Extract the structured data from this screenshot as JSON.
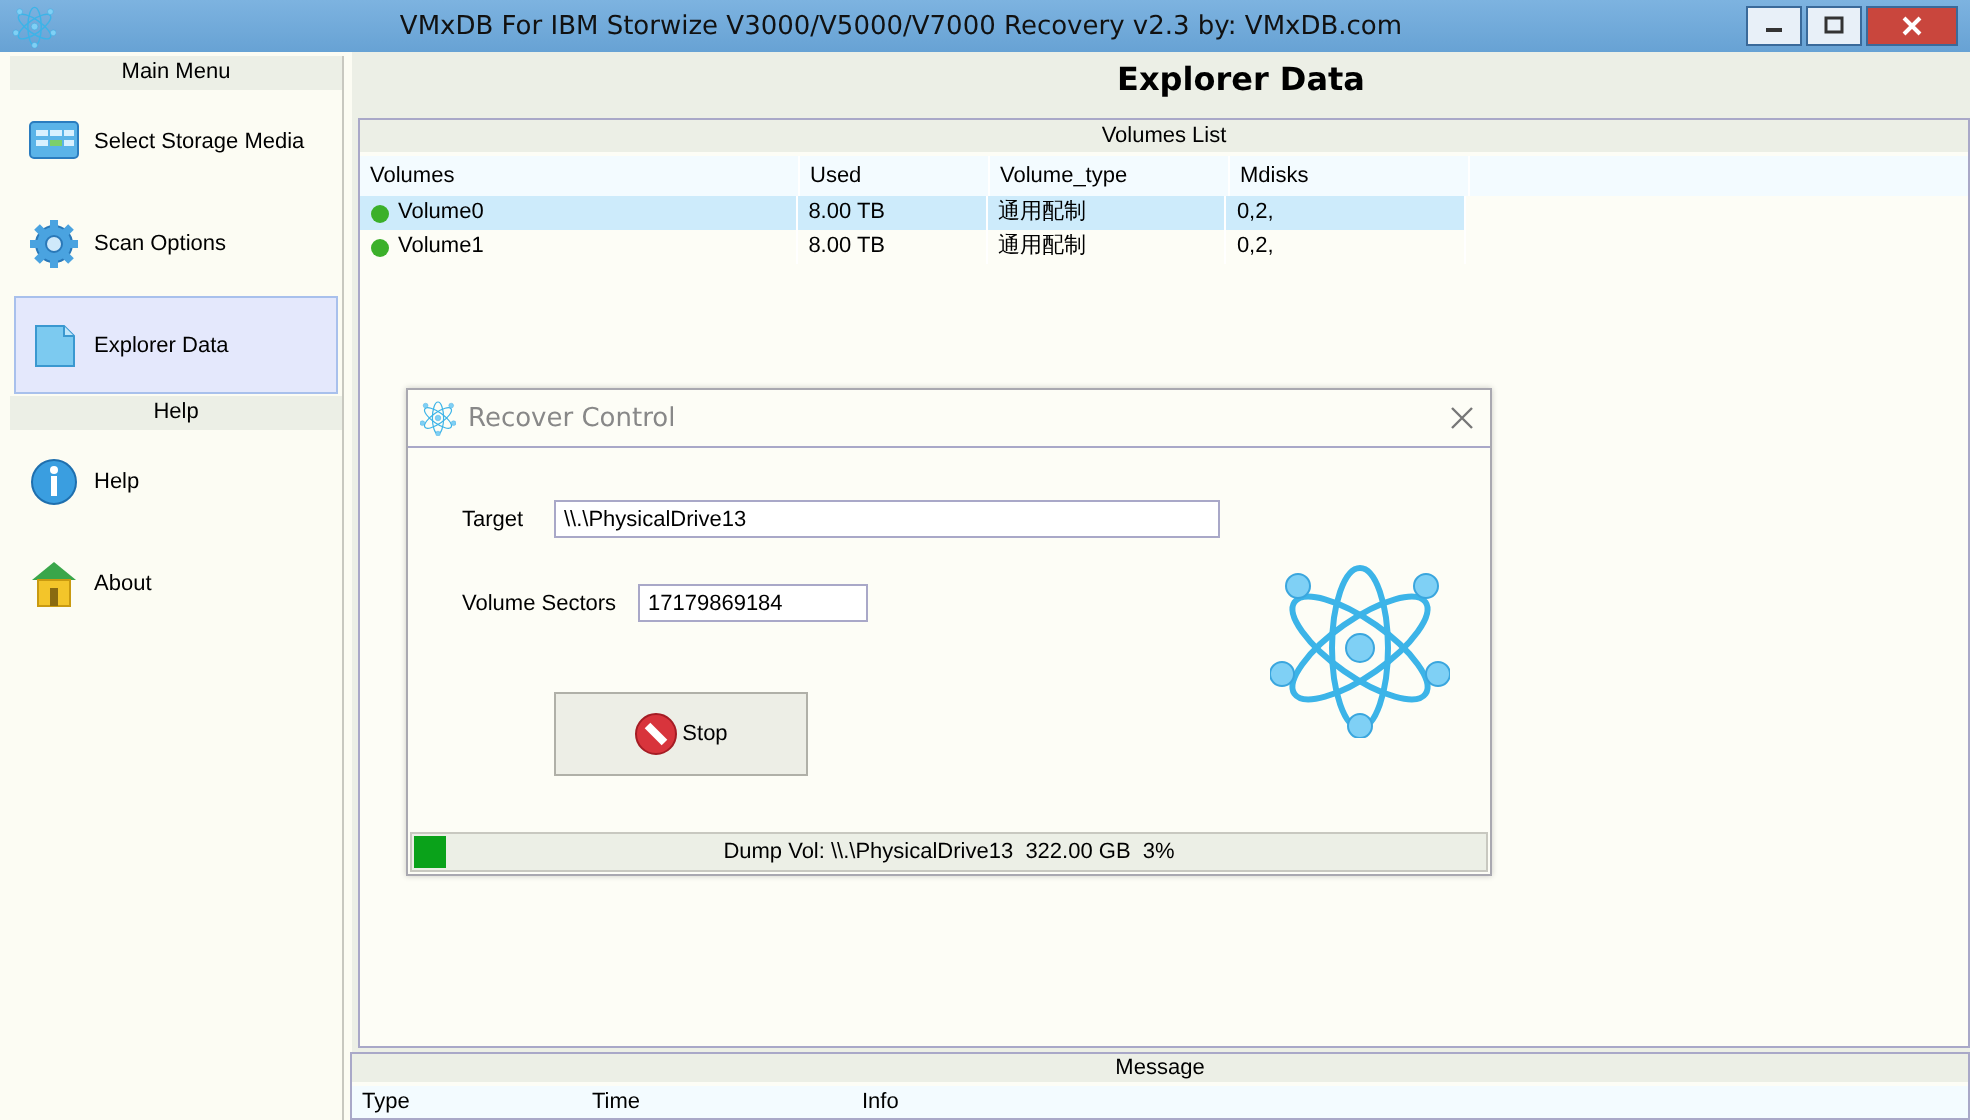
{
  "window": {
    "title": "VMxDB For IBM Storwize V3000/V5000/V7000 Recovery v2.3 by: VMxDB.com"
  },
  "sidebar": {
    "sections": [
      {
        "header": "Main Menu",
        "items": [
          {
            "label": "Select Storage Media",
            "selected": false
          },
          {
            "label": "Scan Options",
            "selected": false
          },
          {
            "label": "Explorer Data",
            "selected": true
          }
        ]
      },
      {
        "header": "Help",
        "items": [
          {
            "label": "Help",
            "selected": false
          },
          {
            "label": "About",
            "selected": false
          }
        ]
      }
    ]
  },
  "heading": "Explorer Data",
  "volumes_list": {
    "title": "Volumes List",
    "columns": [
      "Volumes",
      "Used",
      "Volume_type",
      "Mdisks"
    ],
    "rows": [
      {
        "cells": [
          "Volume0",
          "8.00 TB",
          "通用配制",
          "0,2,"
        ],
        "selected": true
      },
      {
        "cells": [
          "Volume1",
          "8.00 TB",
          "通用配制",
          "0,2,"
        ],
        "selected": false
      }
    ]
  },
  "dialog": {
    "title": "Recover Control",
    "fields": [
      {
        "label": "Target",
        "value": "\\\\.\\PhysicalDrive13"
      },
      {
        "label": "Volume Sectors",
        "value": "17179869184"
      }
    ],
    "button": "Stop",
    "progress": {
      "level": 0.03,
      "text": "Dump Vol: \\\\.\\PhysicalDrive13  322.00 GB  3%"
    }
  },
  "message": {
    "title": "Message",
    "columns": [
      "Type",
      "Time",
      "Info"
    ]
  }
}
